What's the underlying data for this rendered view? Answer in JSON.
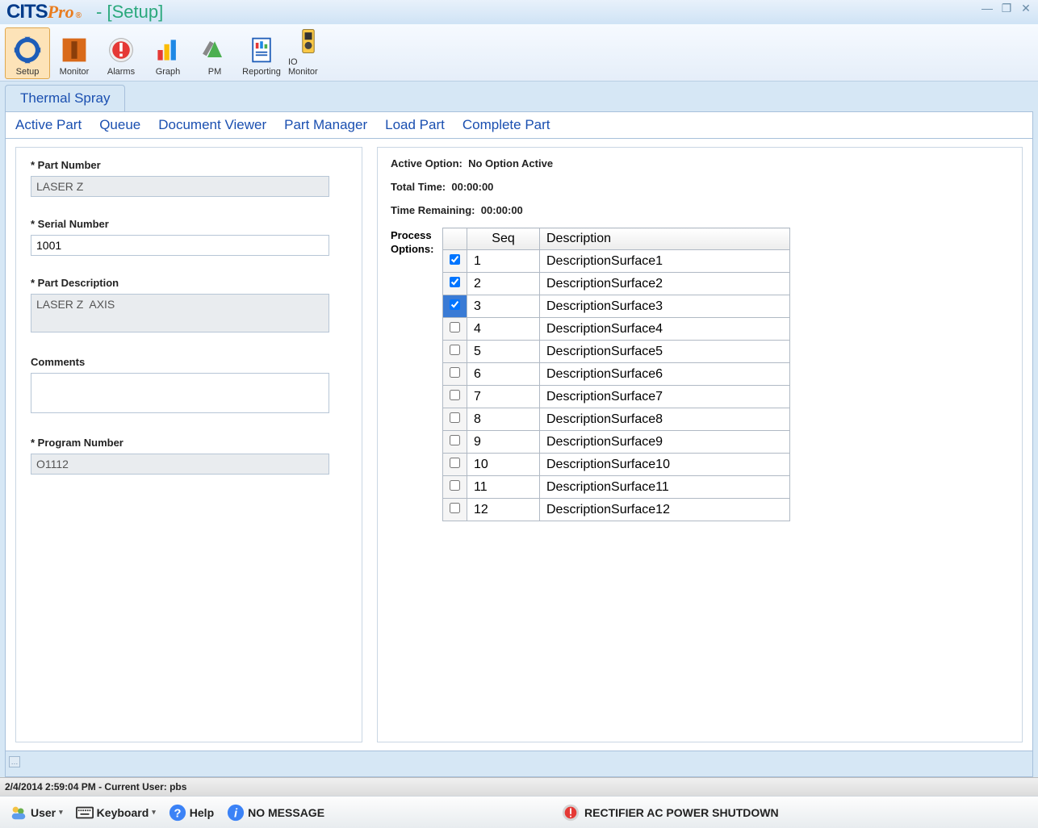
{
  "title_suffix": "- [Setup]",
  "toolbar": [
    {
      "label": "Setup",
      "selected": true
    },
    {
      "label": "Monitor",
      "selected": false
    },
    {
      "label": "Alarms",
      "selected": false
    },
    {
      "label": "Graph",
      "selected": false
    },
    {
      "label": "PM",
      "selected": false
    },
    {
      "label": "Reporting",
      "selected": false
    },
    {
      "label": "IO Monitor",
      "selected": false
    }
  ],
  "tab": "Thermal Spray",
  "subnav": [
    "Active Part",
    "Queue",
    "Document Viewer",
    "Part Manager",
    "Load Part",
    "Complete Part"
  ],
  "form": {
    "part_number_label": "* Part Number",
    "part_number": "LASER Z",
    "serial_number_label": "* Serial Number",
    "serial_number": "1001",
    "part_description_label": "* Part Description",
    "part_description": "LASER Z  AXIS",
    "comments_label": "Comments",
    "comments": "",
    "program_number_label": "* Program Number",
    "program_number": "O1112"
  },
  "info": {
    "active_option_label": "Active Option:",
    "active_option": "No Option Active",
    "total_time_label": "Total Time:",
    "total_time": "00:00:00",
    "time_remaining_label": "Time Remaining:",
    "time_remaining": "00:00:00",
    "process_options_label": "Process Options:"
  },
  "grid": {
    "headers": {
      "seq": "Seq",
      "desc": "Description"
    },
    "rows": [
      {
        "checked": true,
        "selected": false,
        "seq": "1",
        "desc": "DescriptionSurface1"
      },
      {
        "checked": true,
        "selected": false,
        "seq": "2",
        "desc": "DescriptionSurface2"
      },
      {
        "checked": true,
        "selected": true,
        "seq": "3",
        "desc": "DescriptionSurface3"
      },
      {
        "checked": false,
        "selected": false,
        "seq": "4",
        "desc": "DescriptionSurface4"
      },
      {
        "checked": false,
        "selected": false,
        "seq": "5",
        "desc": "DescriptionSurface5"
      },
      {
        "checked": false,
        "selected": false,
        "seq": "6",
        "desc": "DescriptionSurface6"
      },
      {
        "checked": false,
        "selected": false,
        "seq": "7",
        "desc": "DescriptionSurface7"
      },
      {
        "checked": false,
        "selected": false,
        "seq": "8",
        "desc": "DescriptionSurface8"
      },
      {
        "checked": false,
        "selected": false,
        "seq": "9",
        "desc": "DescriptionSurface9"
      },
      {
        "checked": false,
        "selected": false,
        "seq": "10",
        "desc": "DescriptionSurface10"
      },
      {
        "checked": false,
        "selected": false,
        "seq": "11",
        "desc": "DescriptionSurface11"
      },
      {
        "checked": false,
        "selected": false,
        "seq": "12",
        "desc": "DescriptionSurface12"
      }
    ]
  },
  "status": "2/4/2014 2:59:04 PM - Current User:  pbs",
  "footer": {
    "user": "User",
    "keyboard": "Keyboard",
    "help": "Help",
    "no_message": "NO MESSAGE",
    "alert": "RECTIFIER AC POWER SHUTDOWN"
  }
}
